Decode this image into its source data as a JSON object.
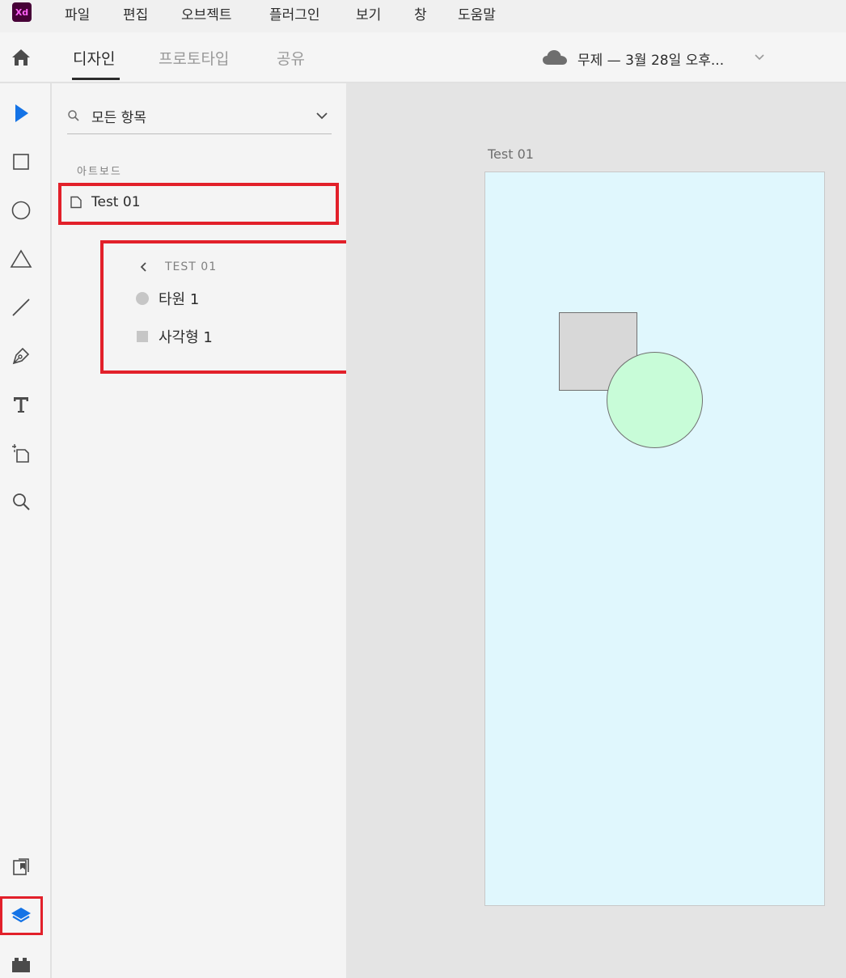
{
  "app": {
    "logo_text": "Xd",
    "brand_color": "#470137",
    "logo_text_color": "#ff61f6"
  },
  "menu": [
    "파일",
    "편집",
    "오브젝트",
    "플러그인",
    "보기",
    "창",
    "도움말"
  ],
  "tabs": [
    {
      "label": "디자인",
      "active": true
    },
    {
      "label": "프로토타입",
      "active": false
    },
    {
      "label": "공유",
      "active": false
    }
  ],
  "document": {
    "title": "무제 — 3월 28일 오후..."
  },
  "tools": [
    "select-icon",
    "rectangle-icon",
    "ellipse-icon",
    "polygon-icon",
    "line-icon",
    "pen-icon",
    "text-icon",
    "artboard-icon",
    "zoom-icon",
    "assets-icon",
    "layers-icon",
    "plugins-icon"
  ],
  "layers_panel": {
    "search_placeholder": "모든 항목",
    "section_label": "아트보드",
    "artboards": [
      {
        "label": "Test 01"
      }
    ],
    "popup": {
      "title": "TEST 01",
      "items": [
        {
          "label": "타원 1",
          "icon": "ellipse-icon"
        },
        {
          "label": "사각형 1",
          "icon": "rectangle-icon"
        }
      ]
    }
  },
  "canvas": {
    "artboard_title": "Test 01",
    "artboard_color": "#e0f7fd",
    "shapes": [
      {
        "type": "rectangle",
        "fill": "#d8d8d8"
      },
      {
        "type": "ellipse",
        "fill": "#c8fcd8"
      }
    ]
  },
  "colors": {
    "highlight": "#e2202a",
    "accent": "#1473e6"
  }
}
